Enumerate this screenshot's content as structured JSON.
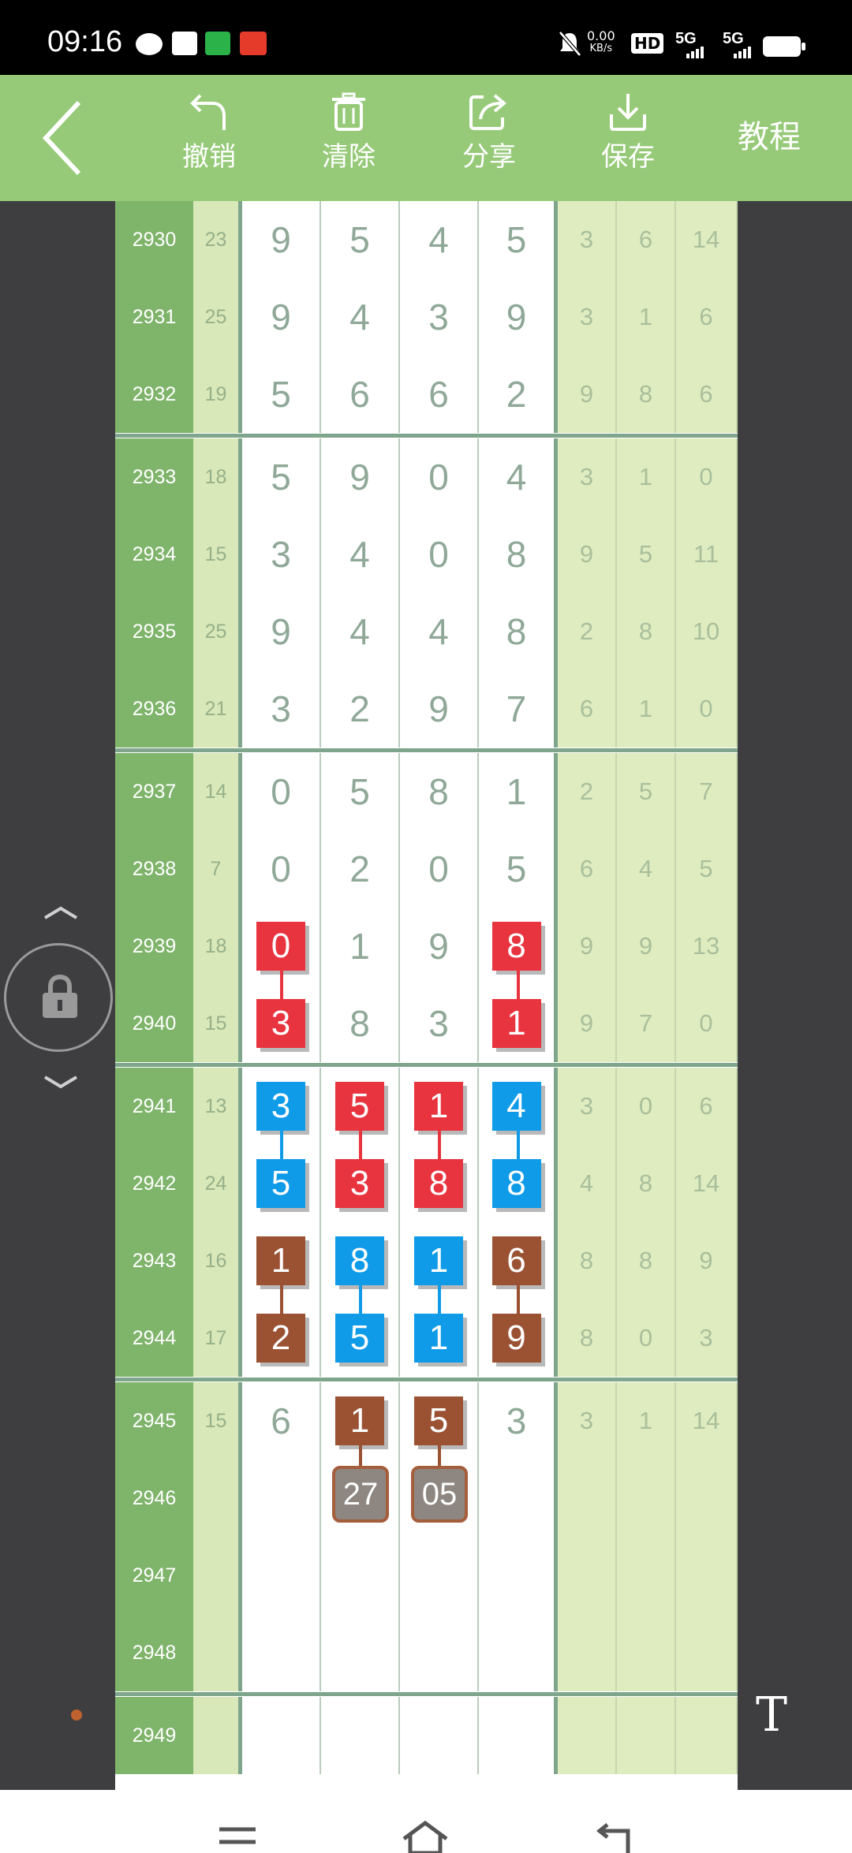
{
  "status_bar": {
    "time": "09:16",
    "net_speed": "0.00",
    "net_unit": "KB/s",
    "hd_label": "HD",
    "sig1": "5G",
    "sig2": "5G"
  },
  "toolbar": {
    "back_icon": "chevron-left-icon",
    "undo_label": "撤销",
    "clear_label": "清除",
    "share_label": "分享",
    "save_label": "保存",
    "tutorial_label": "教程"
  },
  "colors": {
    "toolbar": "#96ca78",
    "id_column": "#7fb46b",
    "red_mark": "#e8343f",
    "blue_mark": "#0f9be8",
    "brown_mark": "#9a5233"
  },
  "rows": [
    {
      "id": "2930",
      "sum": "23",
      "digits": [
        "9",
        "5",
        "4",
        "5"
      ],
      "extra": [
        "3",
        "6",
        "14"
      ]
    },
    {
      "id": "2931",
      "sum": "25",
      "digits": [
        "9",
        "4",
        "3",
        "9"
      ],
      "extra": [
        "3",
        "1",
        "6"
      ]
    },
    {
      "id": "2932",
      "sum": "19",
      "digits": [
        "5",
        "6",
        "6",
        "2"
      ],
      "extra": [
        "9",
        "8",
        "6"
      ]
    },
    {
      "id": "2933",
      "sum": "18",
      "digits": [
        "5",
        "9",
        "0",
        "4"
      ],
      "extra": [
        "3",
        "1",
        "0"
      ]
    },
    {
      "id": "2934",
      "sum": "15",
      "digits": [
        "3",
        "4",
        "0",
        "8"
      ],
      "extra": [
        "9",
        "5",
        "11"
      ]
    },
    {
      "id": "2935",
      "sum": "25",
      "digits": [
        "9",
        "4",
        "4",
        "8"
      ],
      "extra": [
        "2",
        "8",
        "10"
      ]
    },
    {
      "id": "2936",
      "sum": "21",
      "digits": [
        "3",
        "2",
        "9",
        "7"
      ],
      "extra": [
        "6",
        "1",
        "0"
      ]
    },
    {
      "id": "2937",
      "sum": "14",
      "digits": [
        "0",
        "5",
        "8",
        "1"
      ],
      "extra": [
        "2",
        "5",
        "7"
      ]
    },
    {
      "id": "2938",
      "sum": "7",
      "digits": [
        "0",
        "2",
        "0",
        "5"
      ],
      "extra": [
        "6",
        "4",
        "5"
      ]
    },
    {
      "id": "2939",
      "sum": "18",
      "digits": [
        "0",
        "1",
        "9",
        "8"
      ],
      "extra": [
        "9",
        "9",
        "13"
      ]
    },
    {
      "id": "2940",
      "sum": "15",
      "digits": [
        "3",
        "8",
        "3",
        "1"
      ],
      "extra": [
        "9",
        "7",
        "0"
      ]
    },
    {
      "id": "2941",
      "sum": "13",
      "digits": [
        "3",
        "5",
        "1",
        "4"
      ],
      "extra": [
        "3",
        "0",
        "6"
      ]
    },
    {
      "id": "2942",
      "sum": "24",
      "digits": [
        "5",
        "3",
        "8",
        "8"
      ],
      "extra": [
        "4",
        "8",
        "14"
      ]
    },
    {
      "id": "2943",
      "sum": "16",
      "digits": [
        "1",
        "8",
        "1",
        "6"
      ],
      "extra": [
        "8",
        "8",
        "9"
      ]
    },
    {
      "id": "2944",
      "sum": "17",
      "digits": [
        "2",
        "5",
        "1",
        "9"
      ],
      "extra": [
        "8",
        "0",
        "3"
      ]
    },
    {
      "id": "2945",
      "sum": "15",
      "digits": [
        "6",
        "1",
        "5",
        "3"
      ],
      "extra": [
        "3",
        "1",
        "14"
      ]
    },
    {
      "id": "2946",
      "sum": "",
      "digits": [
        "",
        "",
        "",
        ""
      ],
      "extra": [
        "",
        "",
        ""
      ]
    },
    {
      "id": "2947",
      "sum": "",
      "digits": [
        "",
        "",
        "",
        ""
      ],
      "extra": [
        "",
        "",
        ""
      ]
    },
    {
      "id": "2948",
      "sum": "",
      "digits": [
        "",
        "",
        "",
        ""
      ],
      "extra": [
        "",
        "",
        ""
      ]
    },
    {
      "id": "2949",
      "sum": "",
      "digits": [
        "",
        "",
        "",
        ""
      ],
      "extra": [
        "",
        "",
        ""
      ]
    }
  ],
  "marks": [
    {
      "row": 9,
      "col": 0,
      "color": "red"
    },
    {
      "row": 9,
      "col": 3,
      "color": "red"
    },
    {
      "row": 10,
      "col": 0,
      "color": "red"
    },
    {
      "row": 10,
      "col": 3,
      "color": "red"
    },
    {
      "row": 11,
      "col": 0,
      "color": "blue"
    },
    {
      "row": 11,
      "col": 1,
      "color": "red"
    },
    {
      "row": 11,
      "col": 2,
      "color": "red"
    },
    {
      "row": 11,
      "col": 3,
      "color": "blue"
    },
    {
      "row": 12,
      "col": 0,
      "color": "blue"
    },
    {
      "row": 12,
      "col": 1,
      "color": "red"
    },
    {
      "row": 12,
      "col": 2,
      "color": "red"
    },
    {
      "row": 12,
      "col": 3,
      "color": "blue"
    },
    {
      "row": 13,
      "col": 0,
      "color": "brown"
    },
    {
      "row": 13,
      "col": 1,
      "color": "blue"
    },
    {
      "row": 13,
      "col": 2,
      "color": "blue"
    },
    {
      "row": 13,
      "col": 3,
      "color": "brown"
    },
    {
      "row": 14,
      "col": 0,
      "color": "brown"
    },
    {
      "row": 14,
      "col": 1,
      "color": "blue"
    },
    {
      "row": 14,
      "col": 2,
      "color": "blue"
    },
    {
      "row": 14,
      "col": 3,
      "color": "brown"
    },
    {
      "row": 15,
      "col": 1,
      "color": "brown"
    },
    {
      "row": 15,
      "col": 2,
      "color": "brown"
    }
  ],
  "links": [
    {
      "from": 9,
      "col": 0,
      "color": "red"
    },
    {
      "from": 9,
      "col": 3,
      "color": "red"
    },
    {
      "from": 11,
      "col": 0,
      "color": "blue"
    },
    {
      "from": 11,
      "col": 1,
      "color": "red"
    },
    {
      "from": 11,
      "col": 2,
      "color": "red"
    },
    {
      "from": 11,
      "col": 3,
      "color": "blue"
    },
    {
      "from": 13,
      "col": 0,
      "color": "brown"
    },
    {
      "from": 13,
      "col": 1,
      "color": "blue"
    },
    {
      "from": 13,
      "col": 2,
      "color": "blue"
    },
    {
      "from": 13,
      "col": 3,
      "color": "brown"
    },
    {
      "from": 15,
      "col": 1,
      "color": "brown"
    },
    {
      "from": 15,
      "col": 2,
      "color": "brown"
    }
  ],
  "predictions": [
    {
      "row": 16,
      "col": 1,
      "value": "27"
    },
    {
      "row": 16,
      "col": 2,
      "value": "05"
    }
  ],
  "group_breaks": [
    3,
    7,
    11,
    15,
    19
  ],
  "side": {
    "lock_icon": "lock-icon",
    "scroll_up_icon": "chevron-up-icon",
    "scroll_down_icon": "chevron-down-icon",
    "text_tool_label": "T"
  },
  "nav": {
    "menu_icon": "menu-icon",
    "home_icon": "home-icon",
    "back_icon": "back-icon"
  }
}
